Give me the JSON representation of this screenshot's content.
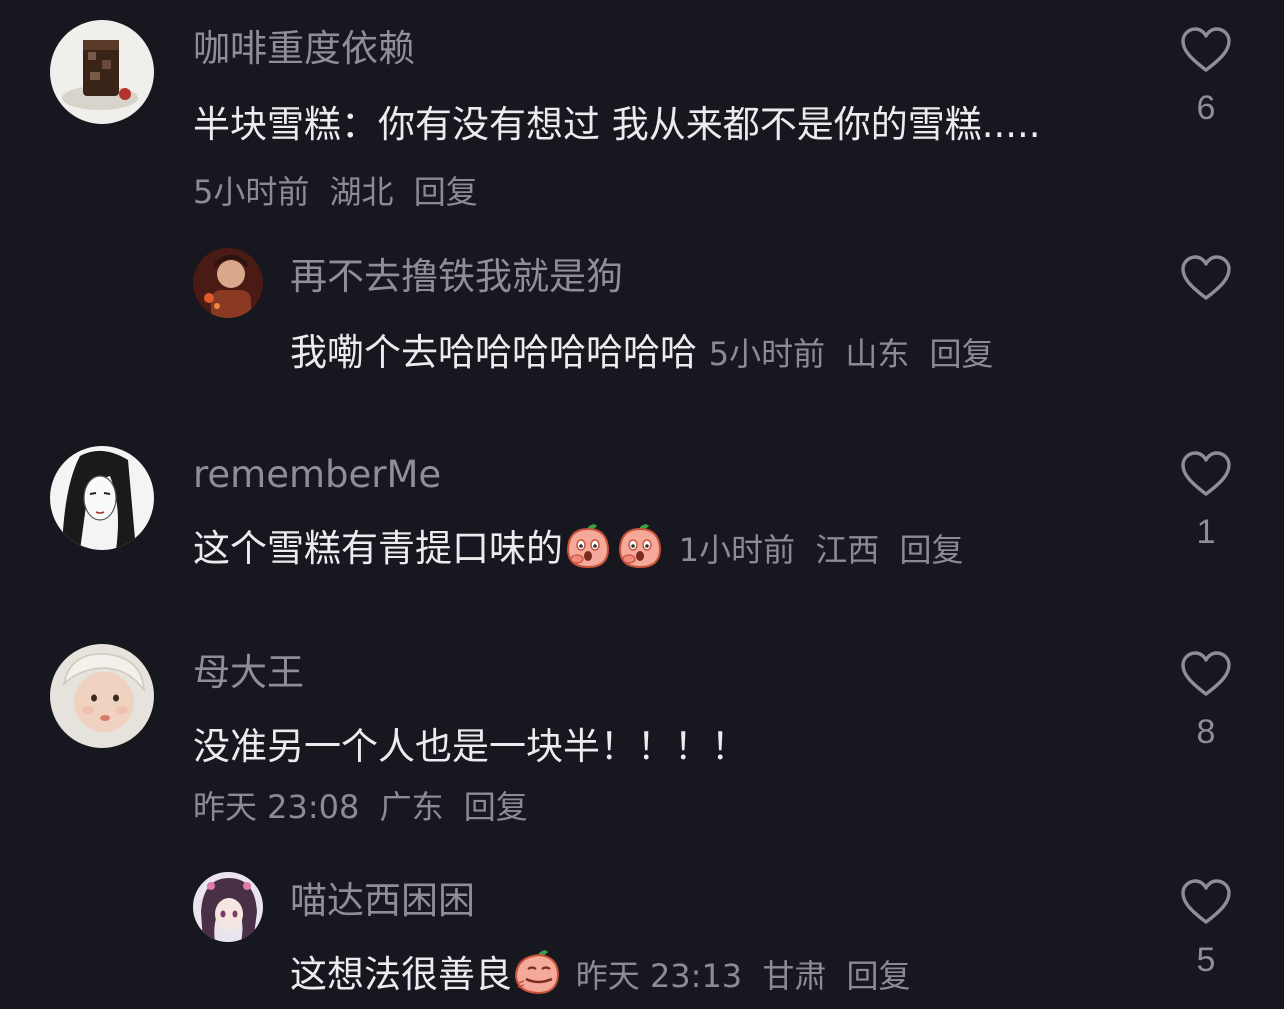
{
  "comments": [
    {
      "username": "咖啡重度依赖",
      "text": "半块雪糕：你有没有想过  我从来都不是你的雪糕.....",
      "time": "5小时前",
      "location": "湖北",
      "reply_label": "回复",
      "likes": "6",
      "avatar_icon": "iced-coffee-avatar",
      "replies": [
        {
          "username": "再不去撸铁我就是狗",
          "text": "我嘞个去哈哈哈哈哈哈哈",
          "time": "5小时前",
          "location": "山东",
          "reply_label": "回复",
          "likes": "",
          "avatar_icon": "portrait-avatar"
        }
      ]
    },
    {
      "username": "rememberMe",
      "text": "这个雪糕有青提口味的",
      "emoji": [
        "shocked-peach-emoji",
        "shocked-peach-emoji"
      ],
      "time": "1小时前",
      "location": "江西",
      "reply_label": "回复",
      "likes": "1",
      "avatar_icon": "sketch-girl-avatar"
    },
    {
      "username": "母大王",
      "text": "没准另一个人也是一块半！！！！",
      "time": "昨天 23:08",
      "location": "广东",
      "reply_label": "回复",
      "likes": "8",
      "avatar_icon": "baby-avatar",
      "replies": [
        {
          "username": "喵达西困困",
          "text": "这想法很善良",
          "emoji": [
            "smirking-peach-emoji"
          ],
          "time": "昨天 23:13",
          "location": "甘肃",
          "reply_label": "回复",
          "likes": "5",
          "avatar_icon": "anime-girl-avatar"
        }
      ]
    }
  ],
  "colors": {
    "background": "#17171f",
    "username": "#8e8e96",
    "text": "#ececee",
    "meta": "#8b8b93",
    "emoji_peach": "#f5a99a"
  }
}
